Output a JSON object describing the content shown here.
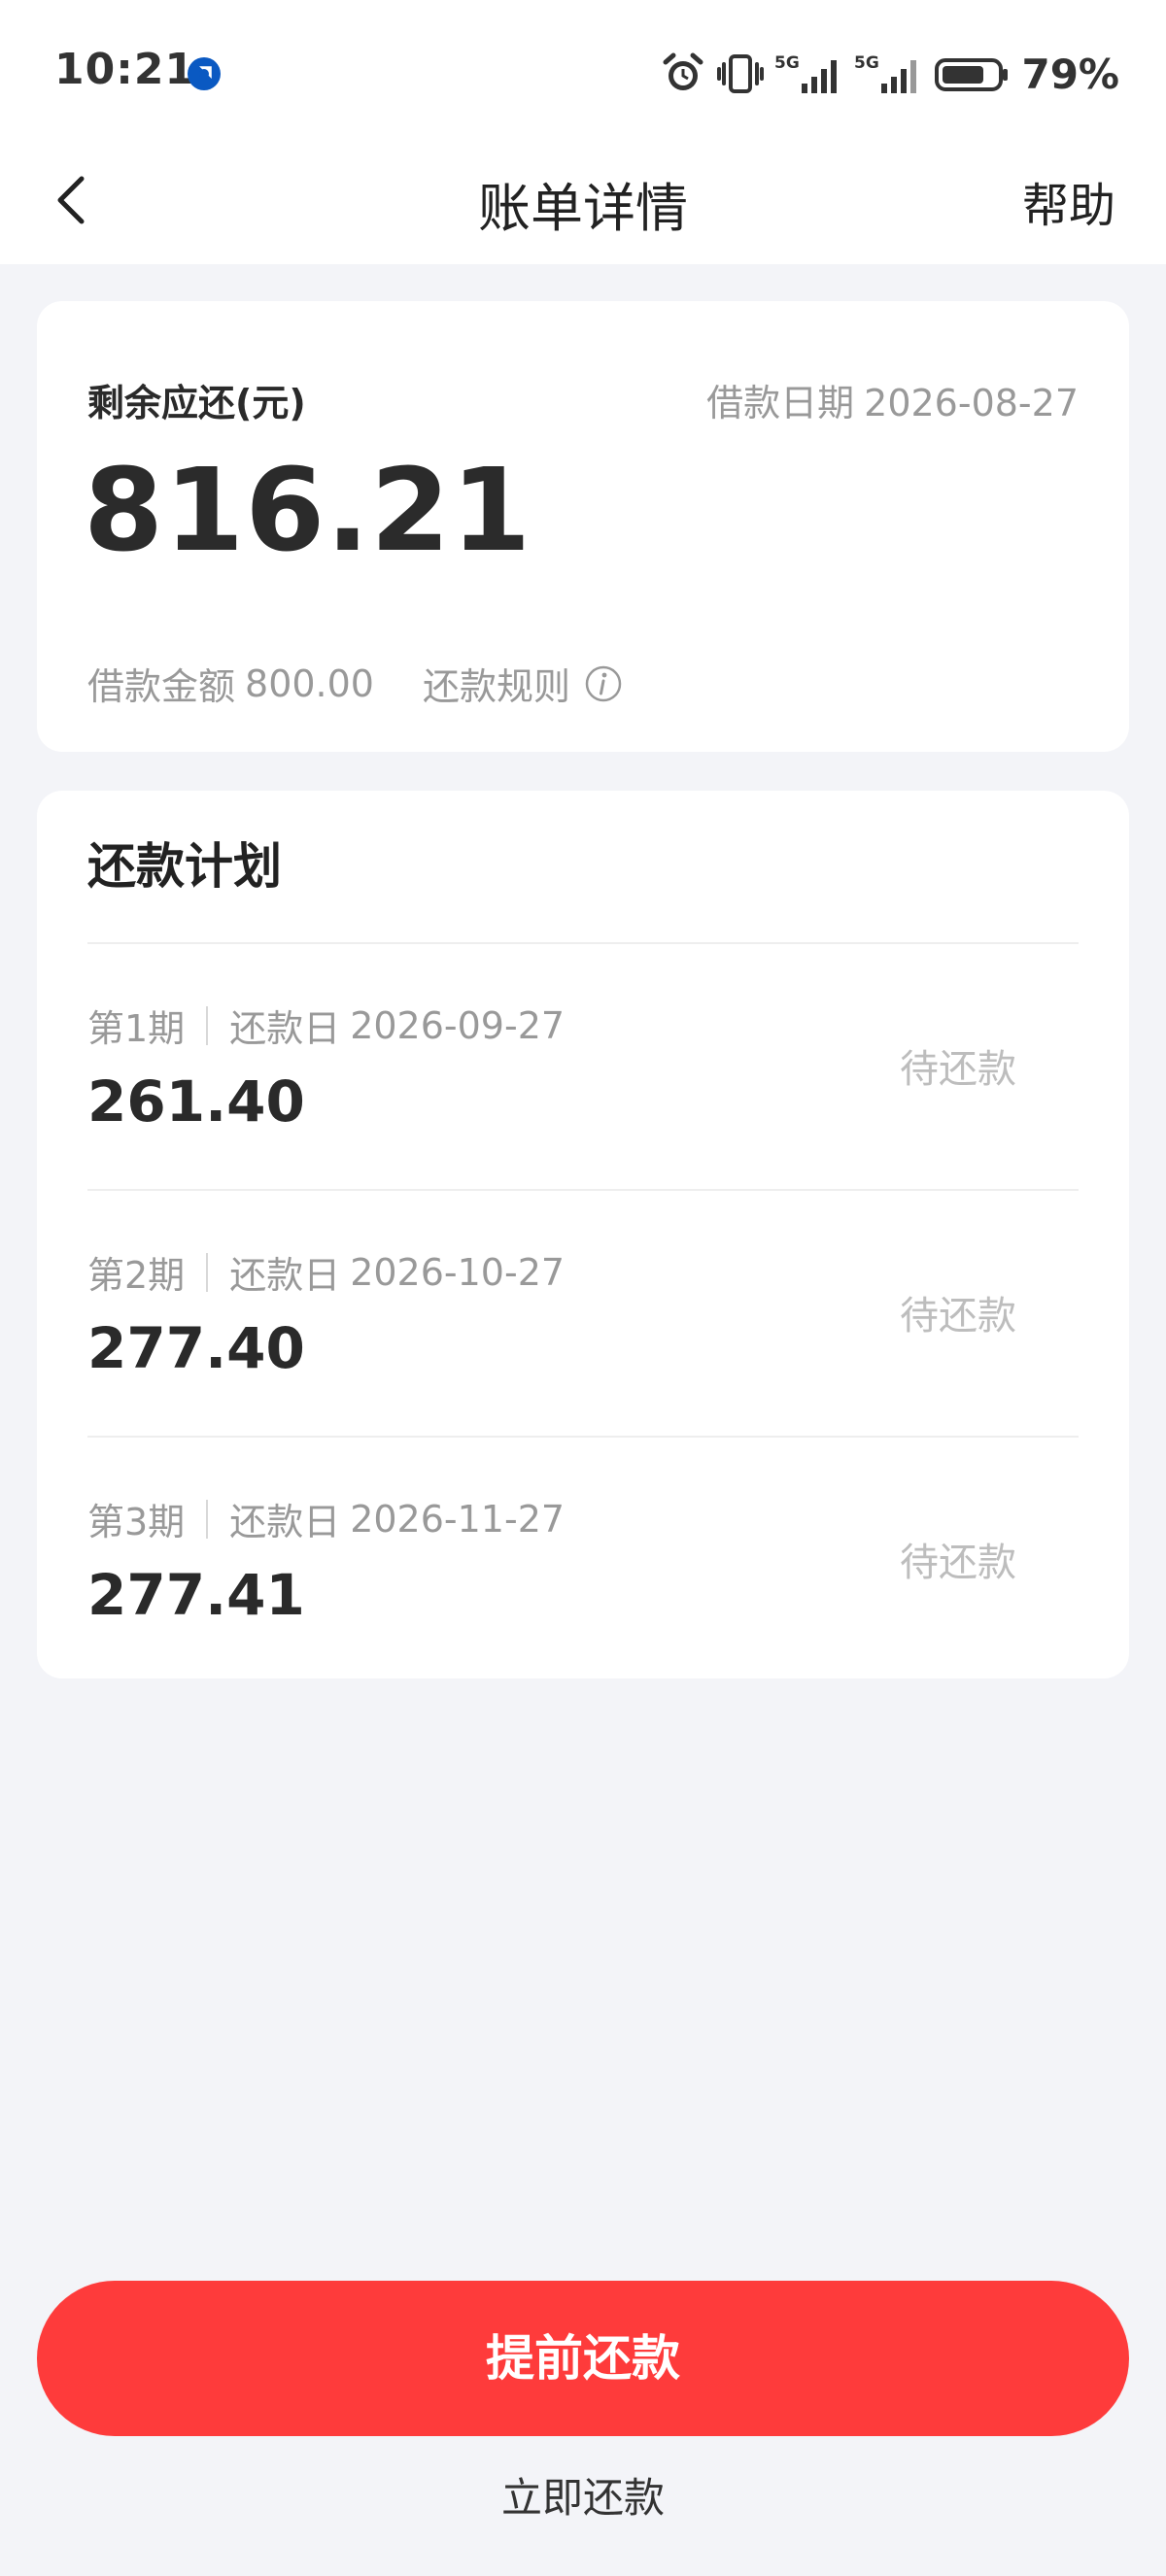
{
  "status_bar": {
    "time": "10:21",
    "battery": "79%",
    "icons": [
      "alarm-icon",
      "vibrate-icon",
      "signal-5g-icon",
      "signal-5g-icon",
      "battery-icon"
    ],
    "app_indicator_color": "#0a59c2"
  },
  "nav": {
    "title": "账单详情",
    "help": "帮助"
  },
  "summary": {
    "label": "剩余应还(元)",
    "remaining": "816.21",
    "loan_date_label": "借款日期",
    "loan_date": "2026-08-27",
    "loan_amount_label": "借款金额",
    "loan_amount": "800.00",
    "rule_label": "还款规则"
  },
  "plan": {
    "title": "还款计划",
    "due_label": "还款日",
    "rows": [
      {
        "period": "第1期",
        "due_date": "2026-09-27",
        "amount": "261.40",
        "status": "待还款"
      },
      {
        "period": "第2期",
        "due_date": "2026-10-27",
        "amount": "277.40",
        "status": "待还款"
      },
      {
        "period": "第3期",
        "due_date": "2026-11-27",
        "amount": "277.41",
        "status": "待还款"
      }
    ]
  },
  "actions": {
    "prepay": "提前还款",
    "pay_now": "立即还款"
  },
  "colors": {
    "accent": "#fe3b3b",
    "background": "#f3f4f8"
  }
}
